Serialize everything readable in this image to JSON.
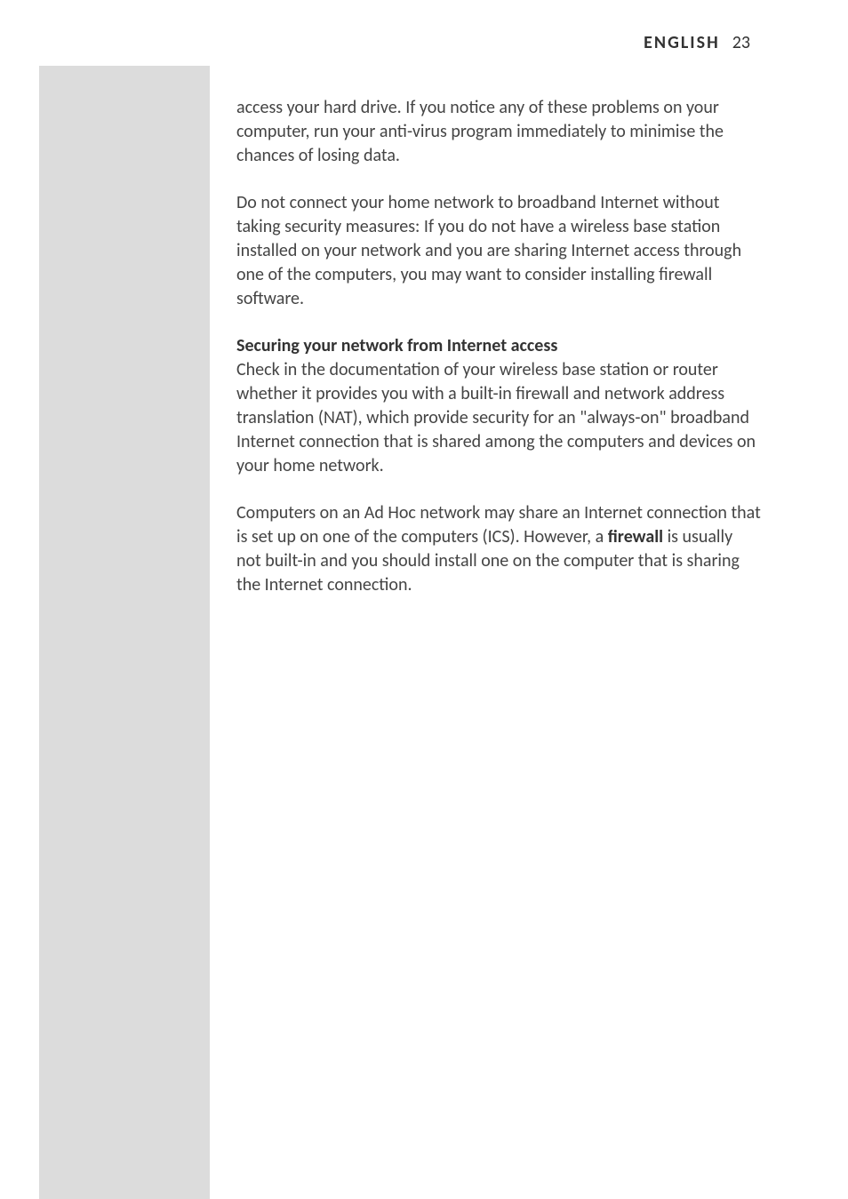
{
  "header": {
    "language": "ENGLISH",
    "page_number": "23"
  },
  "content": {
    "p1": "access your hard drive. If you notice any of these problems on your computer, run your anti-virus program immediately to minimise the chances of losing data.",
    "p2": "Do not connect your home network to broadband Internet without taking security measures: If you do not have a wireless base station installed on your network and you are sharing Internet access through one of the computers, you may want to consider installing firewall software.",
    "heading": "Securing your network from Internet access",
    "p3": "Check in the documentation of your wireless base station or router whether it provides you with a built-in firewall and network address translation (NAT), which provide security for an \"always-on\" broadband Internet connection that is shared among the computers and devices on your home network.",
    "p4_a": "Computers on an Ad Hoc network may share an Internet connection that is set up on one of the computers (ICS). However, a ",
    "p4_bold": "firewall",
    "p4_b": " is usually not built-in and you should install one on the computer that is sharing the Internet connection."
  }
}
